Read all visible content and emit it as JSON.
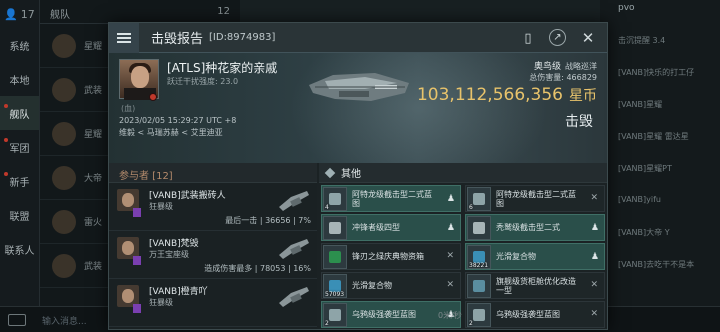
{
  "chat_sidebar": {
    "count": "17",
    "items": [
      {
        "label": "系统",
        "active": false,
        "dot": false
      },
      {
        "label": "本地",
        "active": false,
        "dot": false
      },
      {
        "label": "舰队",
        "active": true,
        "dot": true
      },
      {
        "label": "军团",
        "active": false,
        "dot": true
      },
      {
        "label": "新手",
        "active": false,
        "dot": true
      },
      {
        "label": "联盟",
        "active": false,
        "dot": false
      },
      {
        "label": "联系人",
        "active": false,
        "dot": false
      }
    ]
  },
  "middle_panel": {
    "header": "舰队",
    "header_count": "12",
    "rows": [
      "星耀",
      "武装",
      "星耀",
      "大帝",
      "雷火",
      "武装"
    ]
  },
  "right_panel": {
    "header": "pvo",
    "lines": [
      "击沉提醒 3.4",
      "[VANB]快乐的打工仔",
      "[VANB]星耀",
      "[VANB]星耀 雷达星",
      "[VANB]星耀PT",
      "[VANB]yifu",
      "[VANB]大帝 Y",
      "[VANB]去吃干不是本"
    ]
  },
  "dialog": {
    "title": "击毁报告",
    "kill_id": "[ID:8974983]",
    "victim": {
      "name": "[ATLS]种花家的亲戚",
      "security": "跃迁干扰强度: 23.0",
      "corp_mark": "(血)",
      "datetime": "2023/02/05 15:29:27 UTC +8",
      "location": "维毅 < 马瑞苏赫 < 艾里迪亚"
    },
    "ship": {
      "name": "奥鸟级",
      "class": "战略巡洋",
      "damage_label": "总伤害量:",
      "damage": "466829",
      "isk_value": "103,112,566,356",
      "isk_unit": "星币",
      "result": "击毁"
    },
    "participants_header": "参与者 [12]",
    "participants": [
      {
        "name": "[VANB]武装搬砖人",
        "ship": "狂暴级",
        "stat": "最后一击 | 36656 | 7%"
      },
      {
        "name": "[VANB]梵毁",
        "ship": "万王宝座级",
        "stat": "造成伤害最多 | 78053 | 16%"
      },
      {
        "name": "[VANB]橙青吖",
        "ship": "狂暴级",
        "stat": ""
      }
    ],
    "items_header": "其他",
    "items": [
      {
        "name": "阿特龙级截击型二式蓝图",
        "qty": "4",
        "state": "hl",
        "color": "#8ea4a8",
        "mark": "♟"
      },
      {
        "name": "阿特龙级截击型二式蓝图",
        "qty": "6",
        "state": "dk",
        "color": "#8ea4a8",
        "mark": "✕"
      },
      {
        "name": "冲锋者级四型",
        "qty": "",
        "state": "hl",
        "color": "#a7b4b7",
        "mark": "♟"
      },
      {
        "name": "秃鹫级截击型二式",
        "qty": "",
        "state": "hl",
        "color": "#a7b4b7",
        "mark": "♟"
      },
      {
        "name": "锋刃之绿庆典物资箱",
        "qty": "",
        "state": "dk",
        "color": "#2c8f4e",
        "mark": "✕"
      },
      {
        "name": "光滑复合物",
        "qty": "38221",
        "state": "hl",
        "color": "#3a8fb6",
        "mark": "♟"
      },
      {
        "name": "光滑复合物",
        "qty": "57093",
        "state": "dk",
        "color": "#3a8fb6",
        "mark": "✕"
      },
      {
        "name": "旗舰级货柜舱优化改造 一型",
        "qty": "",
        "state": "dk",
        "color": "#5a8ea0",
        "mark": "✕"
      },
      {
        "name": "乌鸦级强袭型蓝图",
        "qty": "2",
        "state": "hl",
        "color": "#8ea4a8",
        "mark": "♟"
      },
      {
        "name": "乌鸦级强袭型蓝图",
        "qty": "2",
        "state": "dk",
        "color": "#8ea4a8",
        "mark": "✕"
      }
    ],
    "scroll_info": "0米/秒"
  },
  "bottom_input_placeholder": "输入消息..."
}
